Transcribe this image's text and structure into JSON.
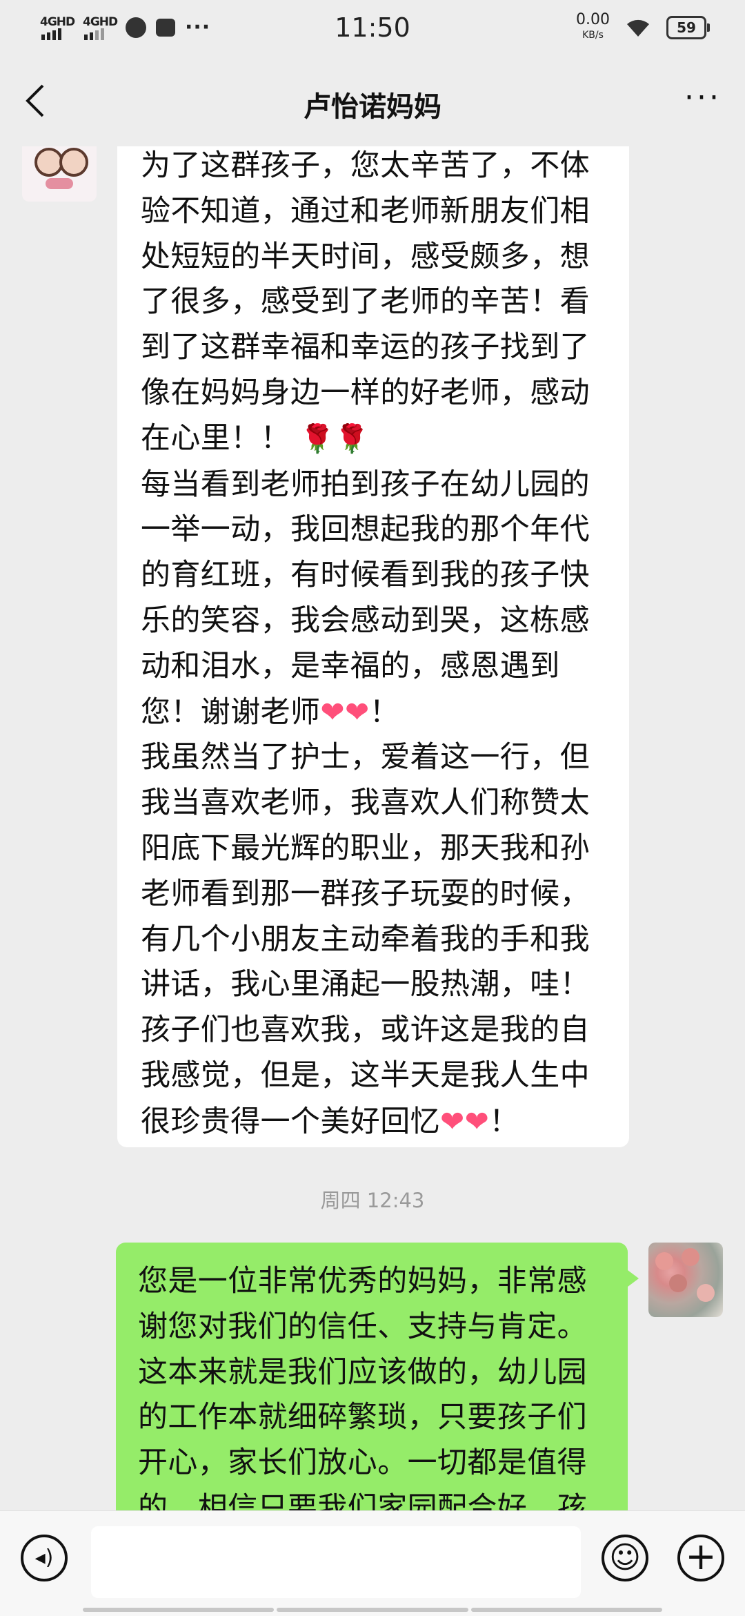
{
  "status_bar": {
    "signal1": "4GHD",
    "signal2": "4GHD",
    "more": "···",
    "time": "11:50",
    "speed_value": "0.00",
    "speed_unit": "KB/s",
    "battery": "59"
  },
  "header": {
    "back_icon": "back-arrow-icon",
    "title": "卢怡诺妈妈",
    "more_label": "···"
  },
  "messages": {
    "incoming": {
      "p1_line1": "为了这群孩子，您太辛苦了，不体验不知道，通过和老师新朋友们相处短短的半天时间，感受颇多，想了很多，感受到了老师的辛苦！看到了这群幸福和幸运的孩子找到了像在妈妈身边一样的好老师，感动在心里！！",
      "flower": "🌹🌹",
      "p2_text": "每当看到老师拍到孩子在幼儿园的一举一动，我回想起我的那个年代的育红班，有时候看到我的孩子快乐的笑容，我会感动到哭，这栋感动和泪水，是幸福的，感恩遇到您！谢谢老师",
      "p2_hearts": "❤❤",
      "p2_end": "！",
      "p3_text": "我虽然当了护士，爱着这一行，但我当喜欢老师，我喜欢人们称赞太阳底下最光辉的职业，那天我和孙老师看到那一群孩子玩耍的时候，有几个小朋友主动牵着我的手和我讲话，我心里涌起一股热潮，哇！孩子们也喜欢我，或许这是我的自我感觉，但是，这半天是我人生中很珍贵得一个美好回忆",
      "p3_hearts": "❤❤",
      "p3_end": "！"
    },
    "timestamp": "周四 12:43",
    "outgoing": {
      "text": "您是一位非常优秀的妈妈，非常感谢您对我们的信任、支持与肯定。这本来就是我们应该做的，幼儿园的工作本就细碎繁琐，只要孩子们开心，家长们放心。一切都是值得的，相信只要我们家园配合好，孩"
    }
  },
  "input_bar": {
    "voice_icon": "voice-icon",
    "voice_glyph": "◂)",
    "emoji_icon": "emoji-icon",
    "emoji_glyph": "☺",
    "plus_icon": "plus-icon",
    "plus_glyph": "+",
    "input_value": ""
  }
}
